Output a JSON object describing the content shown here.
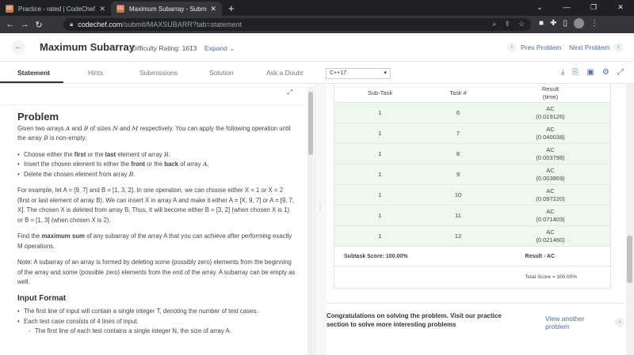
{
  "browser": {
    "tabs": [
      {
        "title": "Practice - rated | CodeChef",
        "favicon": "CC"
      },
      {
        "title": "Maximum Subarray - Submit | C...",
        "favicon": "CC"
      }
    ],
    "url_host": "codechef.com",
    "url_path": "/submit/MAXSUBARR?tab=statement"
  },
  "header": {
    "title": "Maximum Subarray",
    "difficulty": "Difficulty Rating: 1613",
    "expand": "Expand",
    "prev": "Prev Problem",
    "next": "Next Problem"
  },
  "subnav": {
    "tabs": [
      "Statement",
      "Hints",
      "Submissions",
      "Solution",
      "Ask a Doubt"
    ],
    "language": "C++17"
  },
  "problem": {
    "heading": "Problem",
    "intro_a": "Given two arrays ",
    "A": "A",
    "intro_b": " and ",
    "B": "B",
    "intro_c": " of sizes ",
    "N": "N",
    "intro_d": " and ",
    "M": "M",
    "intro_e": " respectively. You can apply the following operation until the array ",
    "intro_f": " is non-empty:",
    "b1a": "Choose either the ",
    "b1b": "first",
    "b1c": " or the ",
    "b1d": "last",
    "b1e": " element of array ",
    "b1f": "B",
    "b1g": ".",
    "b2a": "Insert the chosen element to either the ",
    "b2b": "front",
    "b2c": " or the ",
    "b2d": "back",
    "b2e": " of array ",
    "b2f": "A",
    "b2g": ".",
    "b3a": "Delete the chosen element from array ",
    "b3b": "B",
    "b3c": ".",
    "ex": "For example, let A = [9, 7] and B = [1, 3, 2]. In one operation, we can choose either X = 1 or X = 2 (first or last element of array B). We can insert X in array A and make it either A = [X, 9, 7] or A = [9, 7, X]. The chosen X is deleted from array B. Thus, it will become either B = [3, 2] (when chosen X is 1) or B = [1, 3] (when chosen X is 2).",
    "find_a": "Find the ",
    "find_b": "maximum sum",
    "find_c": " of any subarray of the array A that you can achieve after performing exactly M operations.",
    "note": "Note: A subarray of an array is formed by deleting some (possibly zero) elements from the beginning of the array and some (possible zero) elements from the end of the array. A subarray can be empty as well.",
    "input_heading": "Input Format",
    "in1": "The first line of input will contain a single integer T, denoting the number of test cases.",
    "in2": "Each test case consists of 4 lines of input.",
    "in3": "The first line of each test contains a single integer N, the size of array A."
  },
  "results": {
    "headers": [
      "Sub-Task",
      "Task #",
      "Result\n(time)"
    ],
    "rows": [
      {
        "sub": "1",
        "task": "6",
        "res": "AC",
        "time": "(0.019126)"
      },
      {
        "sub": "1",
        "task": "7",
        "res": "AC",
        "time": "(0.040038)"
      },
      {
        "sub": "1",
        "task": "8",
        "res": "AC",
        "time": "(0.003798)"
      },
      {
        "sub": "1",
        "task": "9",
        "res": "AC",
        "time": "(0.003869)"
      },
      {
        "sub": "1",
        "task": "10",
        "res": "AC",
        "time": "(0.097220)"
      },
      {
        "sub": "1",
        "task": "11",
        "res": "AC",
        "time": "(0.071403)"
      },
      {
        "sub": "1",
        "task": "12",
        "res": "AC",
        "time": "(0.021460)"
      }
    ],
    "subtask_score": "Subtask Score: 100.00%",
    "subtask_result": "Result - AC",
    "total_score": "Total Score = 100.00%"
  },
  "congrats": {
    "message": "Congratulations on solving the problem. Visit our practice section to solve more interesting problems",
    "view_another": "View another problem"
  },
  "colors": {
    "accent": "#4a6fa5",
    "ac_row": "#ecf9ec"
  }
}
